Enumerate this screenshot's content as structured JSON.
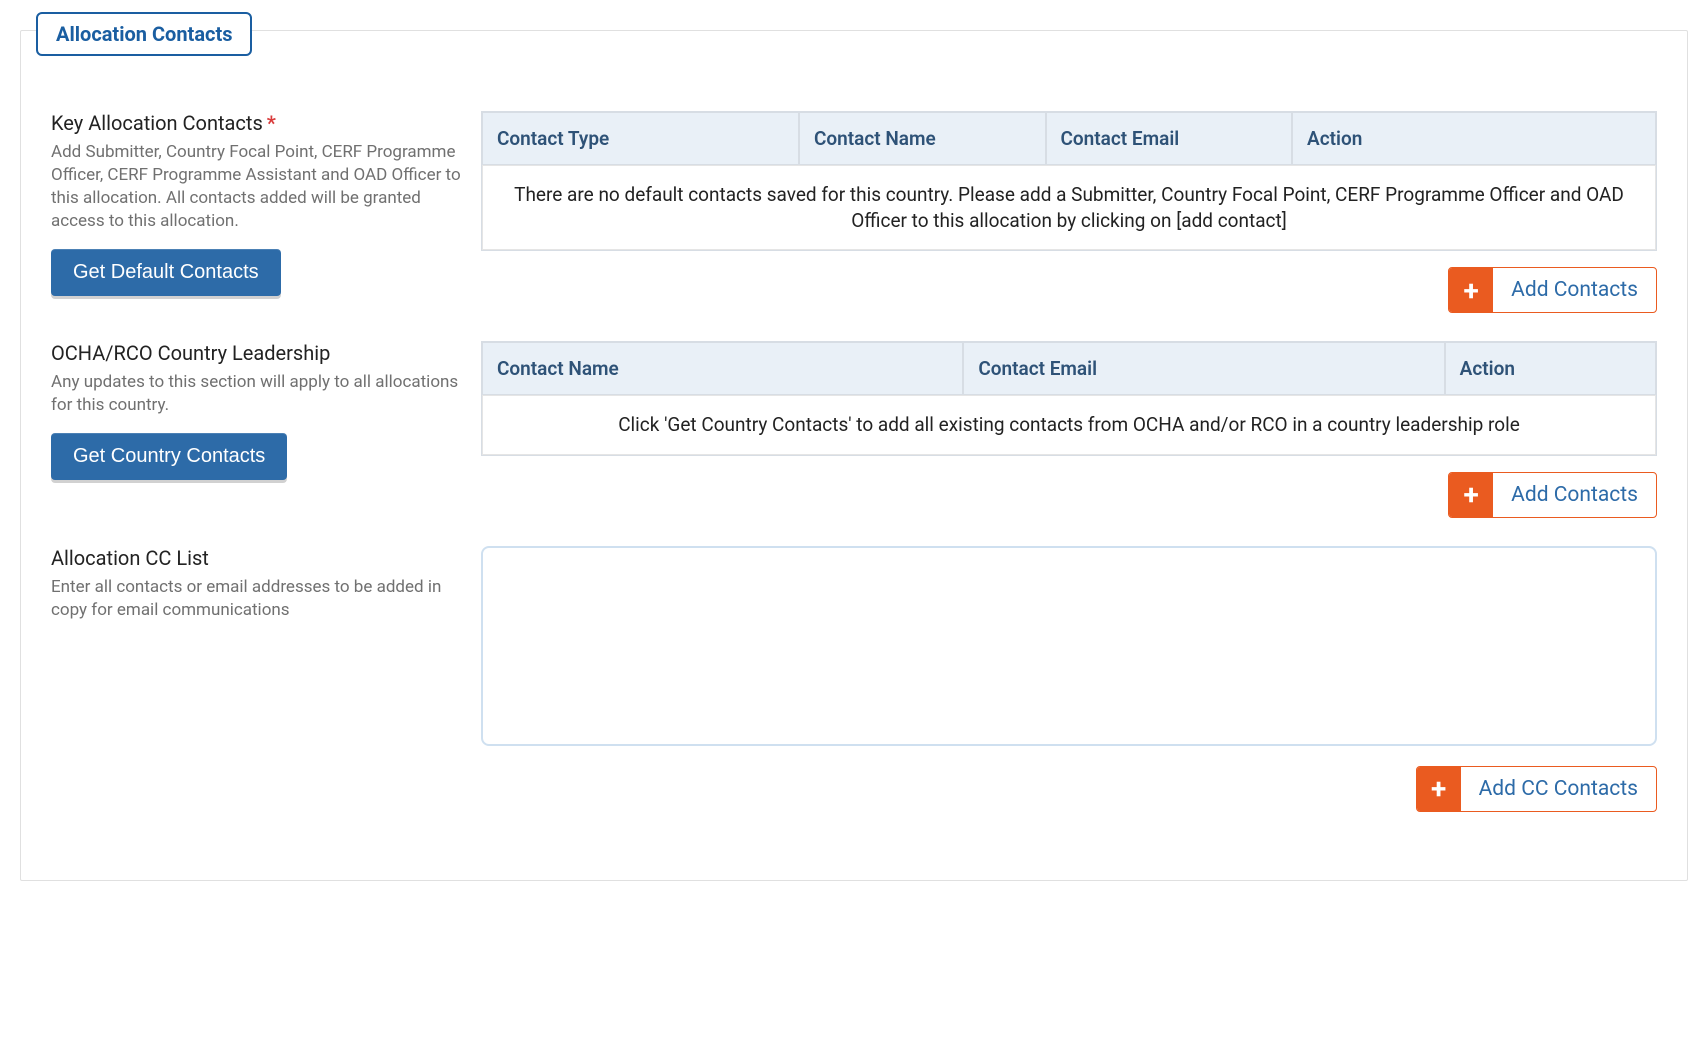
{
  "panel": {
    "legend": "Allocation Contacts"
  },
  "section_key": {
    "title": "Key Allocation Contacts",
    "required_marker": "*",
    "desc": "Add Submitter, Country Focal Point, CERF Programme Officer, CERF Programme Assistant and OAD Officer to this allocation. All contacts added will be granted access to this allocation.",
    "button": "Get Default Contacts",
    "table_headers": {
      "col1": "Contact Type",
      "col2": "Contact Name",
      "col3": "Contact Email",
      "col4": "Action"
    },
    "empty_message": "There are no default contacts saved for this country. Please add a Submitter, Country Focal Point, CERF Programme Officer and OAD Officer to this allocation by clicking on [add contact]",
    "add_button": "Add Contacts"
  },
  "section_leadership": {
    "title": "OCHA/RCO Country Leadership",
    "desc": "Any updates to this section will apply to all allocations for this country.",
    "button": "Get Country Contacts",
    "table_headers": {
      "col1": "Contact Name",
      "col2": "Contact Email",
      "col3": "Action"
    },
    "empty_message": "Click 'Get Country Contacts' to add all existing contacts from OCHA and/or RCO in a country leadership role",
    "add_button": "Add Contacts"
  },
  "section_cc": {
    "title": "Allocation CC List",
    "desc": "Enter all contacts or email addresses to be added in copy for email communications",
    "textarea_value": "",
    "add_button": "Add CC Contacts"
  }
}
